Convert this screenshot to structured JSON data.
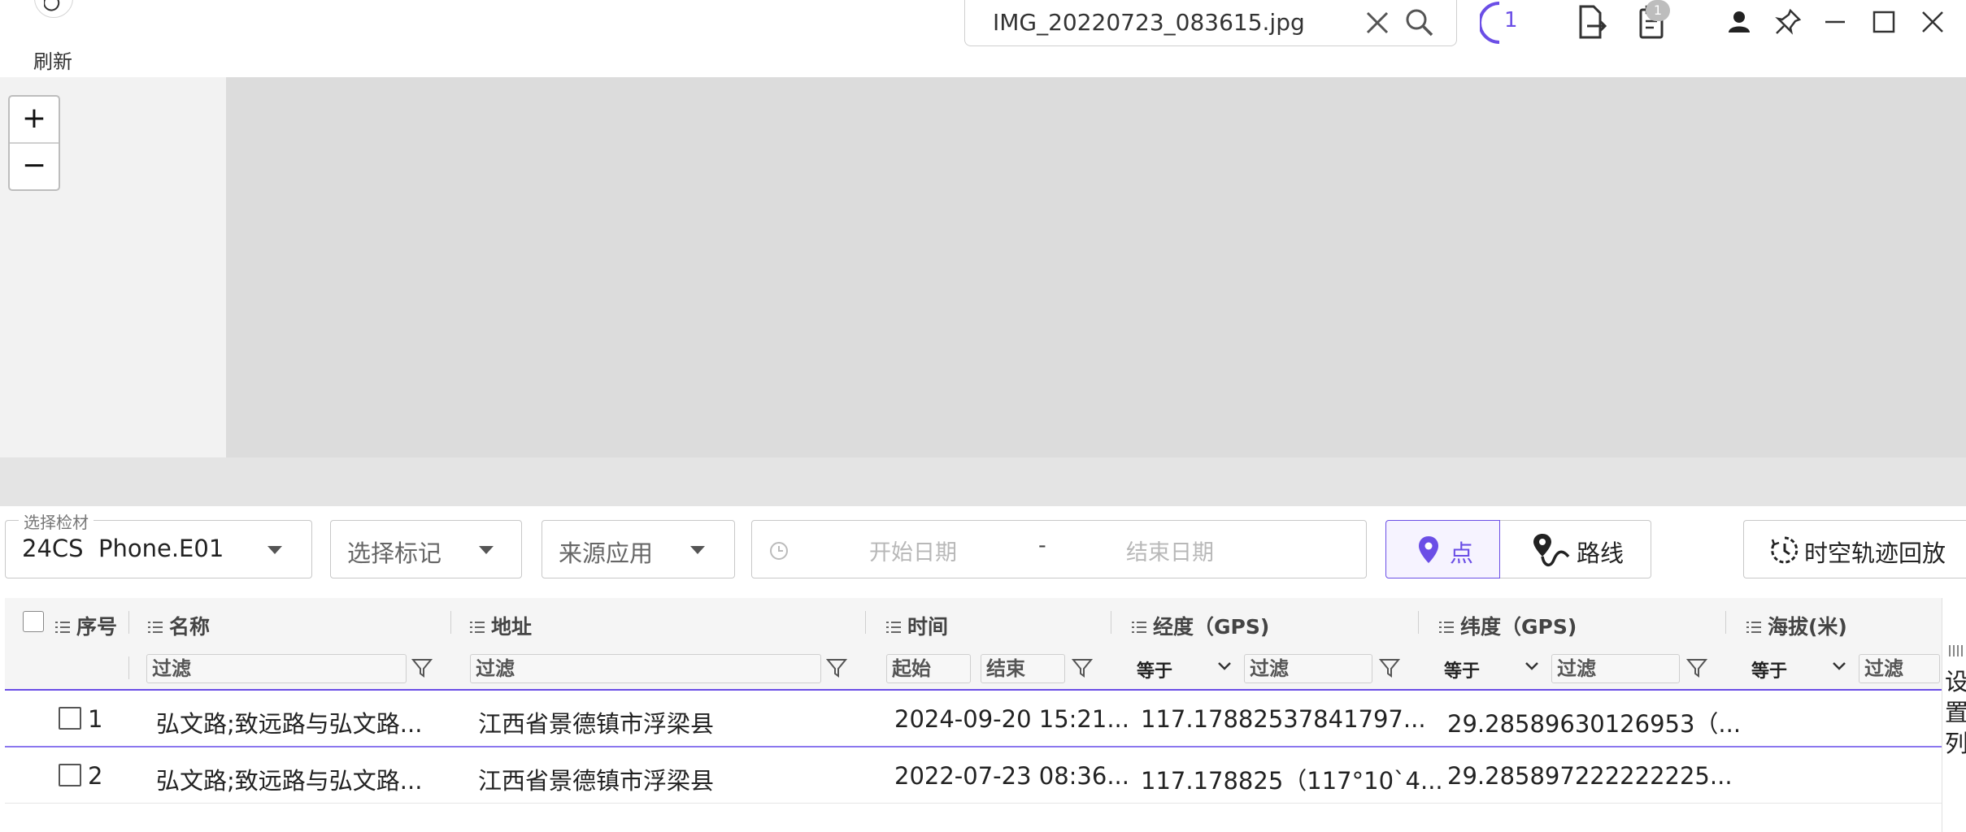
{
  "toolbar": {
    "refresh_label": "刷新"
  },
  "search": {
    "value": "IMG_20220723_083615.jpg"
  },
  "window": {
    "task_progress": "1",
    "clipboard_count": "1"
  },
  "filters": {
    "evidence_legend": "选择检材",
    "evidence_value": "24CS  Phone.E01",
    "mark_placeholder": "选择标记",
    "app_placeholder": "来源应用",
    "start_date_placeholder": "开始日期",
    "date_separator": "-",
    "end_date_placeholder": "结束日期",
    "mode_point": "点",
    "mode_route": "路线",
    "mode_selected": "点",
    "playback_label": "时空轨迹回放"
  },
  "table": {
    "columns": [
      "序号",
      "名称",
      "地址",
      "时间",
      "经度（GPS)",
      "纬度（GPS)",
      "海拔(米)"
    ],
    "filter_placeholder": "过滤",
    "time_start_placeholder": "起始",
    "time_end_placeholder": "结束",
    "op_equals": "等于",
    "rows": [
      {
        "index": "1",
        "name": "弘文路;致远路与弘文路...",
        "address": "江西省景德镇市浮梁县",
        "time": "2024-09-20 15:21...",
        "longitude": "117.17882537841797...",
        "latitude": "29.28589630126953（...",
        "altitude": ""
      },
      {
        "index": "2",
        "name": "弘文路;致远路与弘文路...",
        "address": "江西省景德镇市浮梁县",
        "time": "2022-07-23 08:36...",
        "longitude": "117.178825（117°10`4...",
        "latitude": "29.285897222222225...",
        "altitude": ""
      }
    ],
    "settings_label": "设置列"
  },
  "map": {
    "zoom_in": "+",
    "zoom_out": "−"
  },
  "colors": {
    "accent": "#6b4ee6",
    "map_background": "#dcdcdc"
  }
}
